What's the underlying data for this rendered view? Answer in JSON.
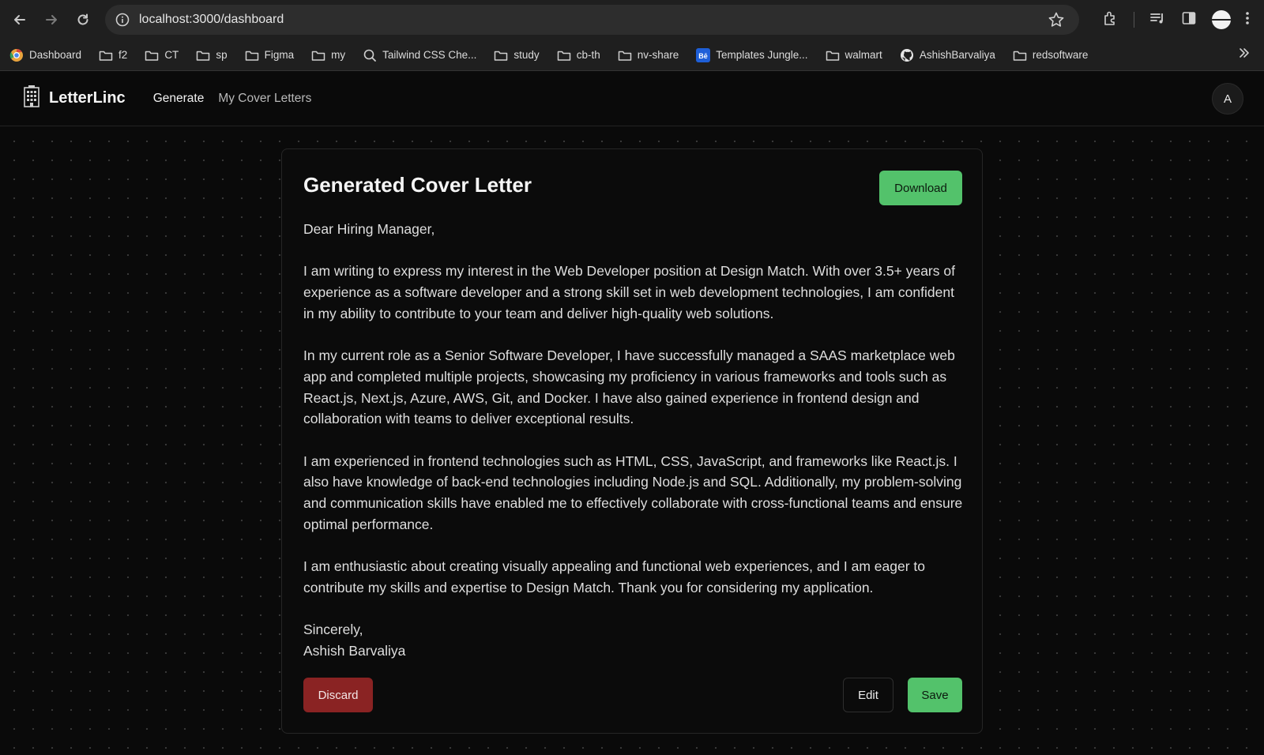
{
  "browser": {
    "url": "localhost:3000/dashboard",
    "bookmarks": [
      {
        "label": "Dashboard",
        "icon": "chrome-icon"
      },
      {
        "label": "f2",
        "icon": "folder-icon"
      },
      {
        "label": "CT",
        "icon": "folder-icon"
      },
      {
        "label": "sp",
        "icon": "folder-icon"
      },
      {
        "label": "Figma",
        "icon": "folder-icon"
      },
      {
        "label": "my",
        "icon": "folder-icon"
      },
      {
        "label": "Tailwind CSS Che...",
        "icon": "search-icon"
      },
      {
        "label": "study",
        "icon": "folder-icon"
      },
      {
        "label": "cb-th",
        "icon": "folder-icon"
      },
      {
        "label": "nv-share",
        "icon": "folder-icon"
      },
      {
        "label": "Templates Jungle...",
        "icon": "behance-icon"
      },
      {
        "label": "walmart",
        "icon": "folder-icon"
      },
      {
        "label": "AshishBarvaliya",
        "icon": "github-icon"
      },
      {
        "label": "redsoftware",
        "icon": "folder-icon"
      }
    ]
  },
  "app": {
    "name": "LetterLinc",
    "nav": {
      "generate": "Generate",
      "my_letters": "My Cover Letters"
    },
    "avatar": "A"
  },
  "card": {
    "title": "Generated Cover Letter",
    "download_label": "Download",
    "discard_label": "Discard",
    "edit_label": "Edit",
    "save_label": "Save",
    "letter": {
      "greeting": "Dear Hiring Manager,",
      "paragraphs": [
        "I am writing to express my interest in the Web Developer position at Design Match. With over 3.5+ years of experience as a software developer and a strong skill set in web development technologies, I am confident in my ability to contribute to your team and deliver high-quality web solutions.",
        "In my current role as a Senior Software Developer, I have successfully managed a SAAS marketplace web app and completed multiple projects, showcasing my proficiency in various frameworks and tools such as React.js, Next.js, Azure, AWS, Git, and Docker. I have also gained experience in frontend design and collaboration with teams to deliver exceptional results.",
        "I am experienced in frontend technologies such as HTML, CSS, JavaScript, and frameworks like React.js. I also have knowledge of back-end technologies including Node.js and SQL. Additionally, my problem-solving and communication skills have enabled me to effectively collaborate with cross-functional teams and ensure optimal performance.",
        "I am enthusiastic about creating visually appealing and functional web experiences, and I am eager to contribute my skills and expertise to Design Match. Thank you for considering my application."
      ],
      "closing": "Sincerely,",
      "signature": "Ashish Barvaliya"
    }
  },
  "colors": {
    "accent_green": "#53c26b",
    "discard_red": "#8a2323",
    "background": "#0a0a0a"
  }
}
